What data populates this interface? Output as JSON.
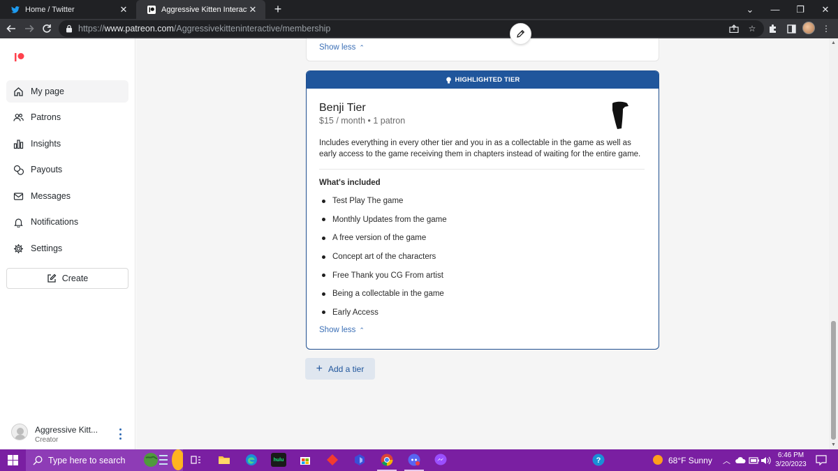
{
  "browser": {
    "tabs": [
      {
        "title": "Home / Twitter",
        "active": false,
        "favicon": "twitter-bird-icon"
      },
      {
        "title": "Aggressive Kitten Interactive | A C",
        "active": true,
        "favicon": "patreon-icon"
      }
    ],
    "url": {
      "scheme": "https://",
      "host": "www.patreon.com",
      "path": "/Aggressivekitteninteractive/membership"
    }
  },
  "sidebar": {
    "items": [
      {
        "label": "My page",
        "icon": "home-icon",
        "active": true
      },
      {
        "label": "Patrons",
        "icon": "users-icon",
        "active": false
      },
      {
        "label": "Insights",
        "icon": "bar-chart-icon",
        "active": false
      },
      {
        "label": "Payouts",
        "icon": "money-icon",
        "active": false
      },
      {
        "label": "Messages",
        "icon": "mail-icon",
        "active": false
      },
      {
        "label": "Notifications",
        "icon": "bell-icon",
        "active": false
      },
      {
        "label": "Settings",
        "icon": "gear-icon",
        "active": false
      }
    ],
    "create_label": "Create",
    "profile": {
      "name": "Aggressive Kitt...",
      "role": "Creator"
    }
  },
  "main": {
    "prev_show_less": "Show less",
    "tier": {
      "banner": "HIGHLIGHTED TIER",
      "name": "Benji Tier",
      "price_line": "$15 / month • 1 patron",
      "description": "Includes everything in every other tier and you in as a collectable in the game as well as early access to the game receiving them in chapters instead of waiting for the entire game.",
      "included_title": "What's included",
      "benefits": [
        "Test Play The game",
        "Monthly Updates from the game",
        "A free version of the game",
        "Concept art of the characters",
        "Free Thank you CG From artist",
        "Being a collectable in the game",
        "Early Access"
      ],
      "show_less": "Show less"
    },
    "add_tier_label": "Add a tier"
  },
  "taskbar": {
    "search_placeholder": "Type here to search",
    "weather": "68°F  Sunny",
    "time": "6:46 PM",
    "date": "3/20/2023",
    "apps": [
      "task-view-icon",
      "file-explorer-icon",
      "edge-icon",
      "hulu-icon",
      "store-icon",
      "red-app-icon",
      "blue-app-icon",
      "chrome-icon",
      "discord-icon",
      "messenger-icon"
    ]
  },
  "colors": {
    "accent_blue": "#20569c",
    "patreon_coral": "#ff424d",
    "taskbar_purple": "#7a1fa2"
  }
}
